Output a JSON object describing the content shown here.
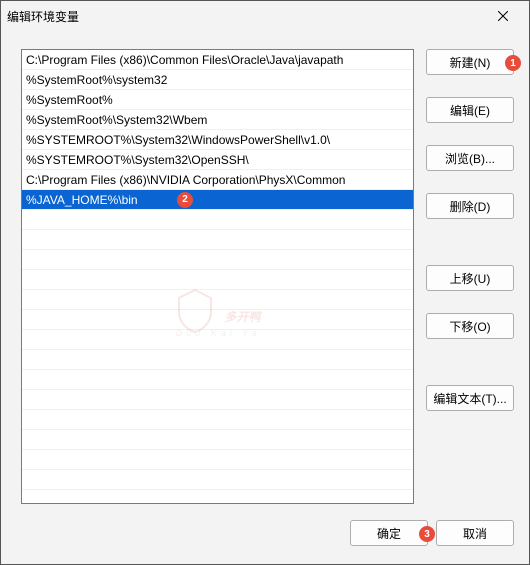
{
  "title": "编辑环境变量",
  "list": {
    "items": [
      "C:\\Program Files (x86)\\Common Files\\Oracle\\Java\\javapath",
      "%SystemRoot%\\system32",
      "%SystemRoot%",
      "%SystemRoot%\\System32\\Wbem",
      "%SYSTEMROOT%\\System32\\WindowsPowerShell\\v1.0\\",
      "%SYSTEMROOT%\\System32\\OpenSSH\\",
      "C:\\Program Files (x86)\\NVIDIA Corporation\\PhysX\\Common",
      "%JAVA_HOME%\\bin"
    ],
    "selected_index": 7
  },
  "buttons": {
    "new": "新建(N)",
    "edit": "编辑(E)",
    "browse": "浏览(B)...",
    "delete": "删除(D)",
    "up": "上移(U)",
    "down": "下移(O)",
    "edit_text": "编辑文本(T)...",
    "ok": "确定",
    "cancel": "取消"
  },
  "annotations": {
    "a1": "1",
    "a2": "2",
    "a3": "3"
  },
  "watermark": {
    "text": "多开鸭",
    "sub": "Duo Kai Ya"
  }
}
